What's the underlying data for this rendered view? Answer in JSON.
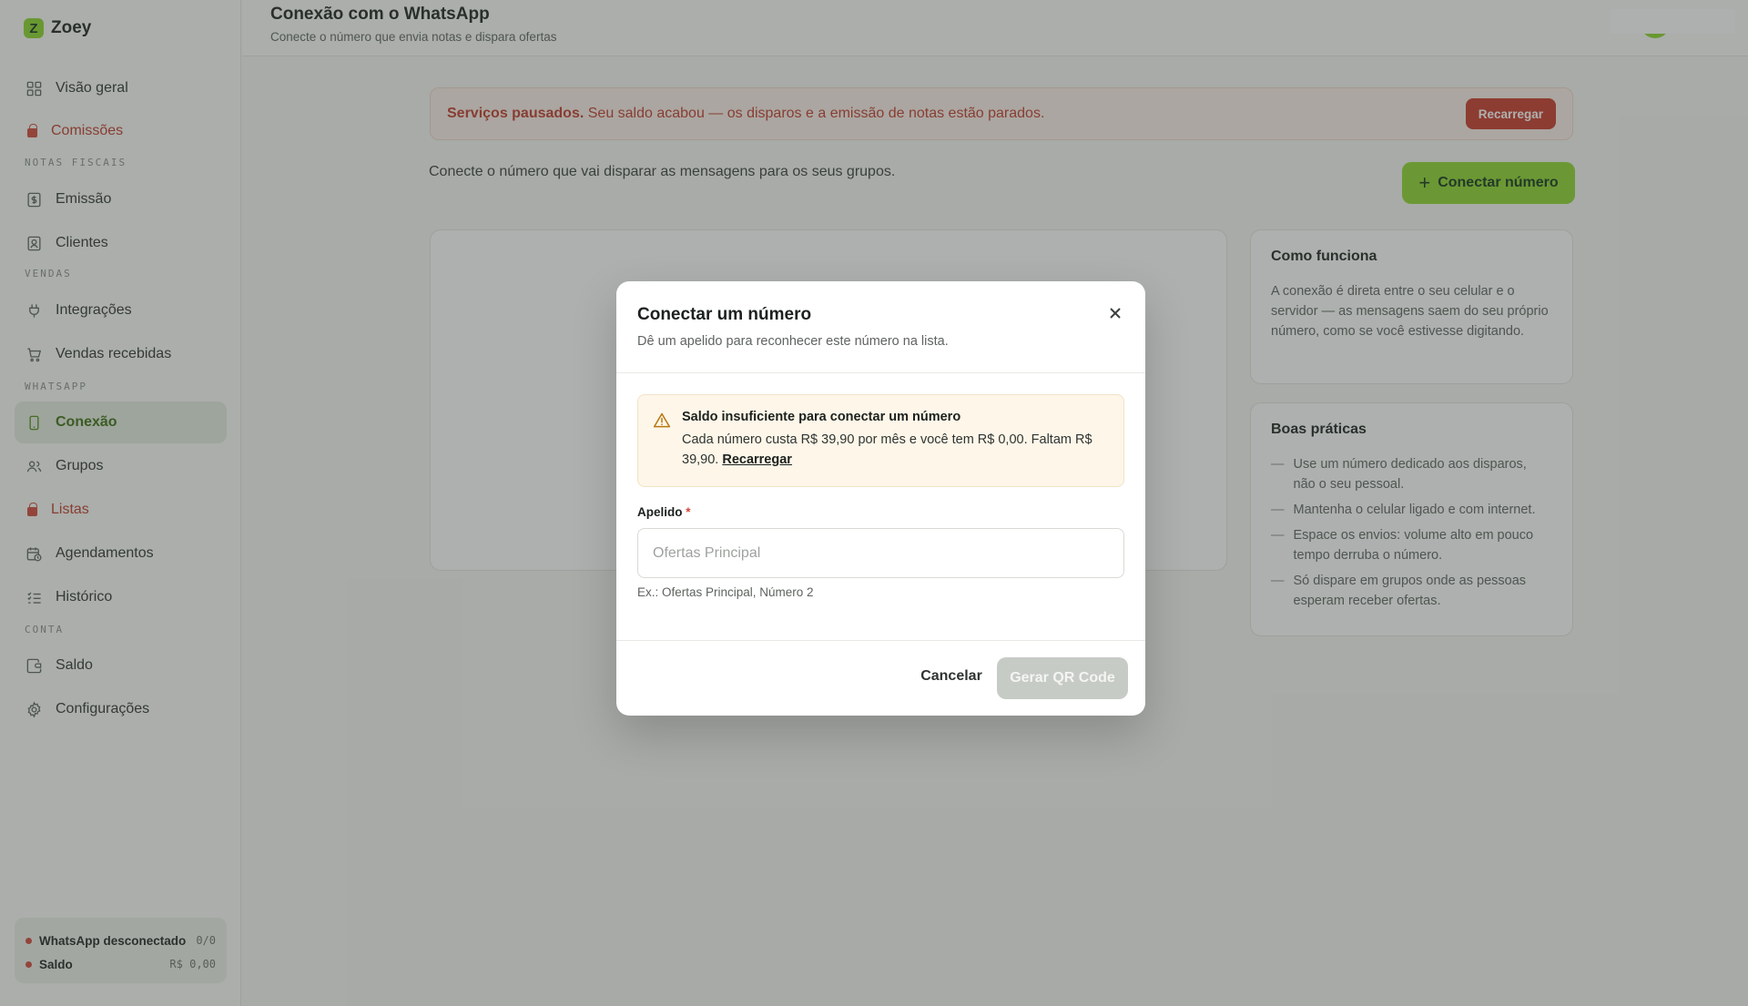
{
  "brand": {
    "name": "Zoey",
    "logo_letter": "Z"
  },
  "sidebar": {
    "items": [
      {
        "label": "Visão geral",
        "icon": "grid-icon"
      },
      {
        "label": "Comissões",
        "icon": "lock-icon"
      },
      {
        "label": "Emissão",
        "icon": "dollar-doc-icon"
      },
      {
        "label": "Clientes",
        "icon": "user-card-icon"
      },
      {
        "label": "Integrações",
        "icon": "plug-icon"
      },
      {
        "label": "Vendas recebidas",
        "icon": "cart-icon"
      },
      {
        "label": "Conexão",
        "icon": "phone-icon"
      },
      {
        "label": "Grupos",
        "icon": "users-icon"
      },
      {
        "label": "Listas",
        "icon": "lock-icon"
      },
      {
        "label": "Agendamentos",
        "icon": "calendar-clock-icon"
      },
      {
        "label": "Histórico",
        "icon": "list-check-icon"
      },
      {
        "label": "Saldo",
        "icon": "wallet-icon"
      },
      {
        "label": "Configurações",
        "icon": "gear-icon"
      }
    ],
    "sections": [
      "NOTAS FISCAIS",
      "VENDAS",
      "WHATSAPP",
      "CONTA"
    ],
    "status": {
      "whatsapp_label": "WhatsApp desconectado",
      "whatsapp_value": "0/0",
      "saldo_label": "Saldo",
      "saldo_value": "R$ 0,00"
    }
  },
  "header": {
    "title": "Conexão com o WhatsApp",
    "subtitle": "Conecte o número que envia notas e dispara ofertas"
  },
  "main": {
    "alert": {
      "bold": "Serviços pausados.",
      "text": " Seu saldo acabou — os disparos e a emissão de notas estão parados.",
      "button": "Recarregar"
    },
    "intro": "Conecte o número que vai disparar as mensagens para os seus grupos.",
    "connect_button": "Conectar número",
    "how_it_works": {
      "title": "Como funciona",
      "text": "A conexão é direta entre o seu celular e o servidor — as mensagens saem do seu próprio número, como se você estivesse digitando."
    },
    "best_practices": {
      "title": "Boas práticas",
      "items": [
        "Use um número dedicado aos disparos, não o seu pessoal.",
        "Mantenha o celular ligado e com internet.",
        "Espace os envios: volume alto em pouco tempo derruba o número.",
        "Só dispare em grupos onde as pessoas esperam receber ofertas."
      ]
    }
  },
  "modal": {
    "title": "Conectar um número",
    "subtitle": "Dê um apelido para reconhecer este número na lista.",
    "warning": {
      "title": "Saldo insuficiente para conectar um número",
      "text": "Cada número custa R$ 39,90 por mês e você tem R$ 0,00. Faltam R$ 39,90. ",
      "link": "Recarregar"
    },
    "field": {
      "label": "Apelido",
      "required_mark": "*",
      "value": "",
      "placeholder": "Ofertas Principal",
      "hint": "Ex.: Ofertas Principal, Número 2"
    },
    "cancel_button": "Cancelar",
    "generate_button": "Gerar QR Code"
  },
  "colors": {
    "accent": "#8ed62d",
    "danger": "#c9382a",
    "warning_bg": "#fdf6e9"
  }
}
